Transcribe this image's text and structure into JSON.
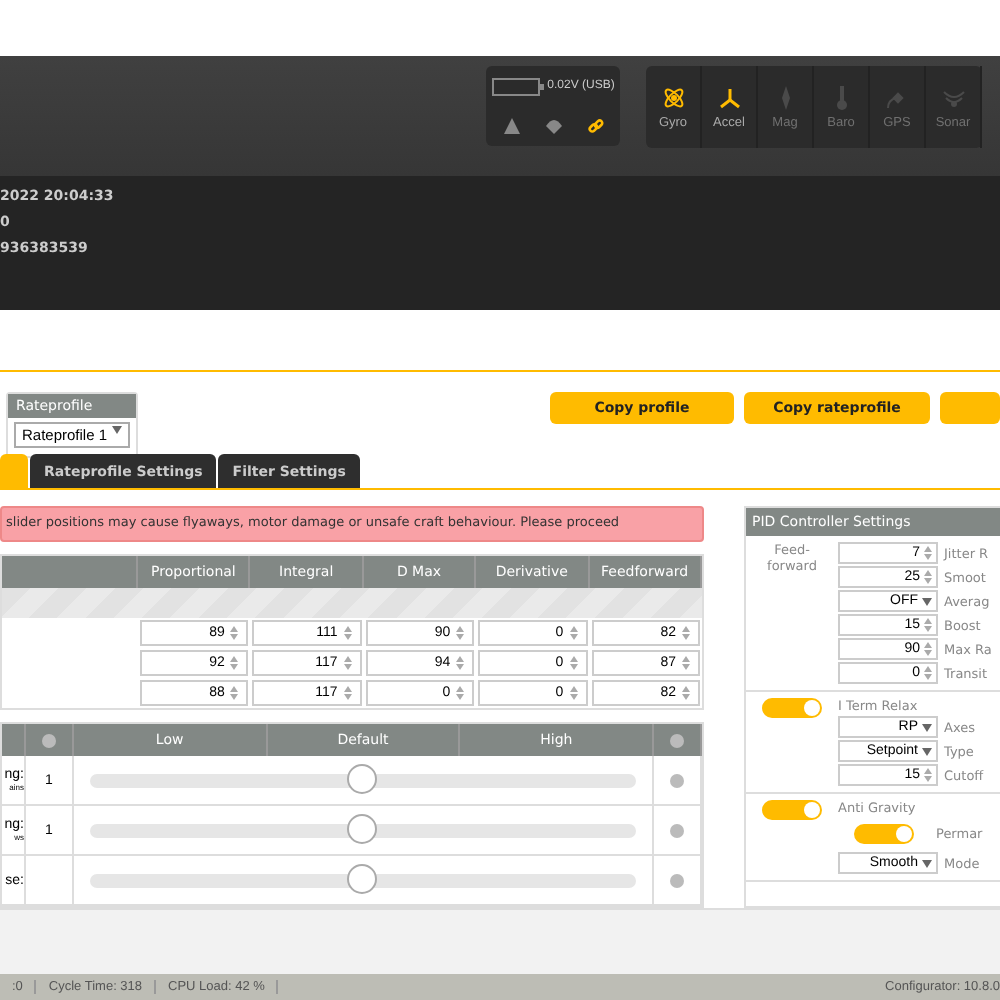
{
  "header": {
    "battery": {
      "reading": "0.02V (USB)"
    },
    "status_icons": [
      {
        "kind": "warning",
        "on": false
      },
      {
        "kind": "parachute",
        "on": false
      },
      {
        "kind": "link",
        "on": true
      }
    ],
    "sensors": [
      {
        "label": "Gyro",
        "kind": "gyro",
        "on": true
      },
      {
        "label": "Accel",
        "kind": "accel",
        "on": true
      },
      {
        "label": "Mag",
        "kind": "mag",
        "on": false
      },
      {
        "label": "Baro",
        "kind": "baro",
        "on": false
      },
      {
        "label": "GPS",
        "kind": "gps",
        "on": false
      },
      {
        "label": "Sonar",
        "kind": "sonar",
        "on": false
      }
    ]
  },
  "log": [
    "2022 20:04:33",
    "0",
    "936383539"
  ],
  "rateprofile": {
    "title": "Rateprofile",
    "value": "Rateprofile 1"
  },
  "copy_buttons": [
    "Copy profile",
    "Copy rateprofile"
  ],
  "tabs": [
    {
      "selected": true
    },
    {
      "label": "Rateprofile Settings",
      "selected": false
    },
    {
      "label": "Filter Settings",
      "selected": false
    }
  ],
  "warning": "slider positions may cause flyaways, motor damage or unsafe craft behaviour. Please proceed",
  "pid_table": {
    "columns": [
      "Proportional",
      "Integral",
      "D Max",
      "Derivative",
      "Feedforward"
    ],
    "rows": [
      [
        "89",
        "111",
        "90",
        "0",
        "82"
      ],
      [
        "92",
        "117",
        "94",
        "0",
        "87"
      ],
      [
        "88",
        "117",
        "0",
        "0",
        "82"
      ]
    ]
  },
  "slider_table": {
    "columns": [
      "Low",
      "Default",
      "High"
    ],
    "rows": [
      {
        "label": "ng:",
        "sublabel": "ains",
        "value": "1",
        "level": 0.5
      },
      {
        "label": "ng:",
        "sublabel": "ws",
        "value": "1",
        "level": 0.5
      },
      {
        "label": "se:",
        "value": "",
        "level": 0.5
      }
    ]
  },
  "pid_settings": {
    "title": "PID Controller Settings",
    "sections": [
      {
        "label": "Feed-\nforward",
        "rows": [
          {
            "kind": "number",
            "value": "7",
            "label": "Jitter R"
          },
          {
            "kind": "number",
            "value": "25",
            "label": "Smoot"
          },
          {
            "kind": "select",
            "value": "OFF",
            "label": "Averag"
          },
          {
            "kind": "number",
            "value": "15",
            "label": "Boost"
          },
          {
            "kind": "number",
            "value": "90",
            "label": "Max Ra"
          },
          {
            "kind": "number",
            "value": "0",
            "label": "Transit"
          }
        ]
      },
      {
        "toggle": true,
        "title": "I Term Relax",
        "rows": [
          {
            "kind": "select",
            "value": "RP",
            "label": "Axes"
          },
          {
            "kind": "select",
            "value": "Setpoint",
            "label": "Type"
          },
          {
            "kind": "number",
            "value": "15",
            "label": "Cutoff"
          }
        ]
      },
      {
        "toggle": true,
        "title": "Anti Gravity",
        "rows": [
          {
            "kind": "toggle",
            "on": true,
            "label": "Permar"
          },
          {
            "kind": "select",
            "value": "Smooth",
            "label": "Mode"
          }
        ]
      }
    ]
  },
  "status_bar": {
    "items": [
      ":0",
      "Cycle Time: 318",
      "CPU Load: 42 %"
    ],
    "version": "Configurator: 10.8.0"
  }
}
